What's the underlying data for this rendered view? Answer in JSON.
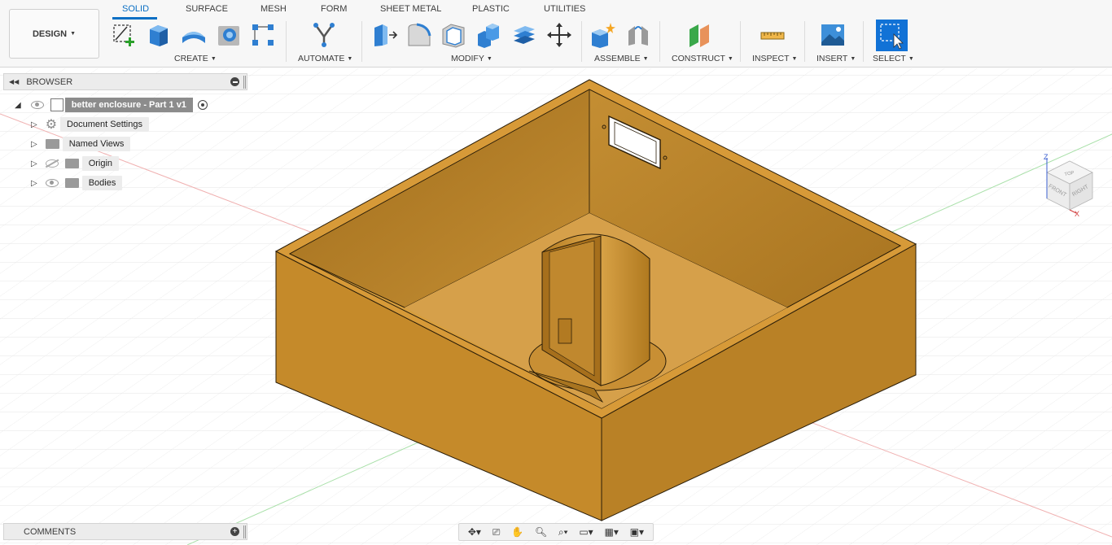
{
  "toolbar": {
    "workspace_label": "DESIGN",
    "tabs": [
      "SOLID",
      "SURFACE",
      "MESH",
      "FORM",
      "SHEET METAL",
      "PLASTIC",
      "UTILITIES"
    ],
    "groups": {
      "create": "CREATE",
      "automate": "AUTOMATE",
      "modify": "MODIFY",
      "assemble": "ASSEMBLE",
      "construct": "CONSTRUCT",
      "inspect": "INSPECT",
      "insert": "INSERT",
      "select": "SELECT"
    },
    "accent_color": "#0b6fc4"
  },
  "browser": {
    "title": "BROWSER",
    "root": "better enclosure - Part 1 v1",
    "items": [
      "Document Settings",
      "Named Views",
      "Origin",
      "Bodies"
    ]
  },
  "comments": {
    "title": "COMMENTS"
  },
  "viewcube": {
    "front": "FRONT",
    "right": "RIGHT",
    "top": "TOP",
    "axis_z": "Z",
    "axis_x": "X"
  },
  "model": {
    "color": "#c78d2d"
  }
}
